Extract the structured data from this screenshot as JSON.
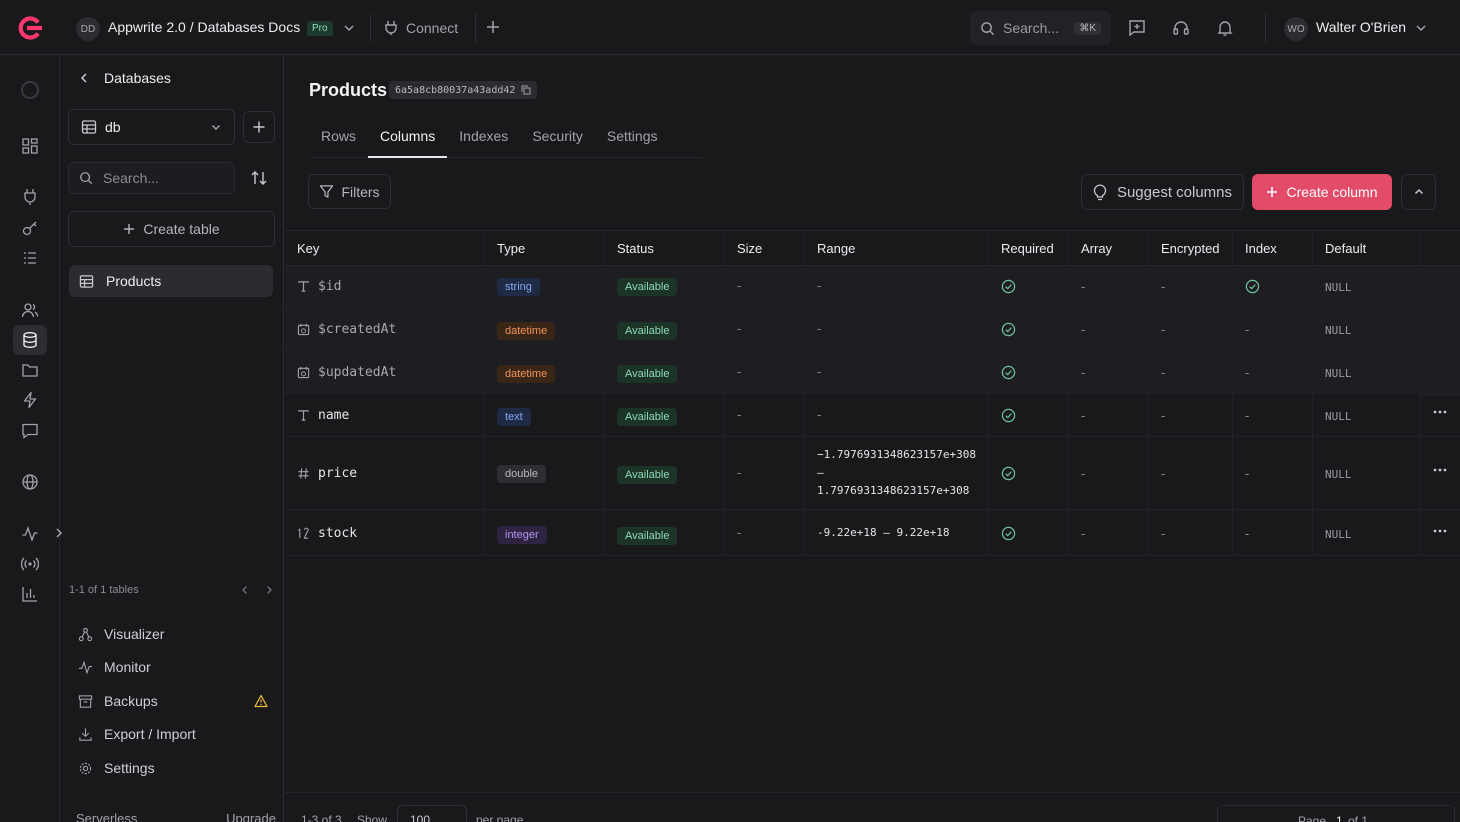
{
  "topbar": {
    "project_initials": "DD",
    "project_title": "Appwrite 2.0 / Databases Docs",
    "plan_badge": "Pro",
    "connect_label": "Connect",
    "search_placeholder": "Search...",
    "search_shortcut": "⌘K",
    "user_initials": "WO",
    "user_name": "Walter O'Brien"
  },
  "colors": {
    "accent": "#e24c68",
    "background": "#19191c",
    "available": "#8fdbb5",
    "warning": "#e9b83f"
  },
  "sidebar": {
    "back_label": "Databases",
    "database_name": "db",
    "search_placeholder": "Search...",
    "create_table_label": "Create table",
    "tables": [
      {
        "name": "Products"
      }
    ],
    "pagination_text": "1-1 of 1 tables",
    "nav": [
      {
        "label": "Visualizer",
        "icon": "visualizer-icon"
      },
      {
        "label": "Monitor",
        "icon": "monitor-icon"
      },
      {
        "label": "Backups",
        "icon": "backups-icon"
      },
      {
        "label": "Export / Import",
        "icon": "export-import-icon"
      },
      {
        "label": "Settings",
        "icon": "settings-icon"
      }
    ],
    "footer_left": "Serverless",
    "footer_right": "Upgrade"
  },
  "main": {
    "title": "Products",
    "table_id": "6a5a8cb80037a43add42",
    "tabs": [
      "Rows",
      "Columns",
      "Indexes",
      "Security",
      "Settings"
    ],
    "active_tab": "Columns",
    "filters_label": "Filters",
    "suggest_label": "Suggest columns",
    "create_column_label": "Create column",
    "columns": [
      "Key",
      "Type",
      "Status",
      "Size",
      "Range",
      "Required",
      "Array",
      "Encrypted",
      "Index",
      "Default"
    ],
    "rows": [
      {
        "key": "$id",
        "icon": "text-icon",
        "type": "string",
        "status": "Available",
        "size": "-",
        "range": "-",
        "required": true,
        "array": "-",
        "encrypted": "-",
        "index": true,
        "default": "NULL",
        "system": true
      },
      {
        "key": "$createdAt",
        "icon": "calendar-icon",
        "type": "datetime",
        "status": "Available",
        "size": "-",
        "range": "-",
        "required": true,
        "array": "-",
        "encrypted": "-",
        "index": "-",
        "default": "NULL",
        "system": true
      },
      {
        "key": "$updatedAt",
        "icon": "calendar-icon",
        "type": "datetime",
        "status": "Available",
        "size": "-",
        "range": "-",
        "required": true,
        "array": "-",
        "encrypted": "-",
        "index": "-",
        "default": "NULL",
        "system": true
      },
      {
        "key": "name",
        "icon": "text-icon",
        "type": "text",
        "status": "Available",
        "size": "-",
        "range": "-",
        "required": true,
        "array": "-",
        "encrypted": "-",
        "index": "-",
        "default": "NULL",
        "system": false
      },
      {
        "key": "price",
        "icon": "hash-icon",
        "type": "double",
        "status": "Available",
        "size": "-",
        "range_lines": [
          "−1.7976931348623157e+308",
          "–",
          "1.7976931348623157e+308"
        ],
        "required": true,
        "array": "-",
        "encrypted": "-",
        "index": "-",
        "default": "NULL",
        "system": false
      },
      {
        "key": "stock",
        "icon": "integer-icon",
        "type": "integer",
        "status": "Available",
        "size": "-",
        "range": "-9.22e+18 – 9.22e+18",
        "required": true,
        "array": "-",
        "encrypted": "-",
        "index": "-",
        "default": "NULL",
        "system": false
      }
    ],
    "footer": {
      "count_text": "1-3 of 3",
      "show_label": "Show",
      "per_page_value": "100",
      "per_page_label": "per page",
      "page_label": "Page",
      "page_current": "1",
      "page_of": "of 1"
    }
  }
}
